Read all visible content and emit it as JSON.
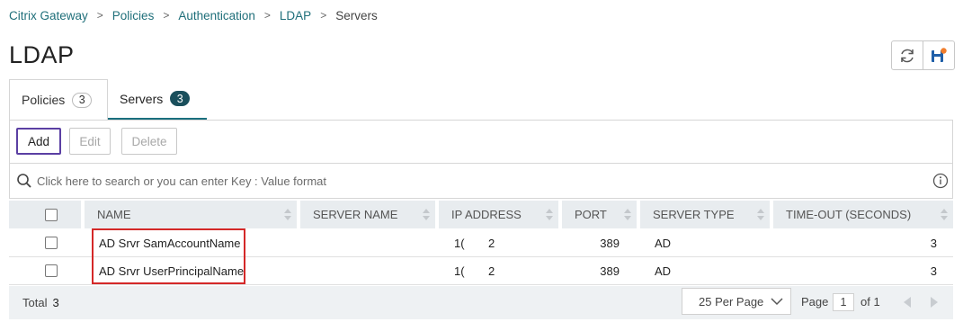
{
  "breadcrumb": {
    "items": [
      "Citrix Gateway",
      "Policies",
      "Authentication",
      "LDAP"
    ],
    "current": "Servers",
    "separator": ">"
  },
  "page_title": "LDAP",
  "toolbar": {
    "refresh_icon": "refresh-icon",
    "save_icon": "save-config-icon"
  },
  "tabs": [
    {
      "label": "Policies",
      "count": "3",
      "active": false
    },
    {
      "label": "Servers",
      "count": "3",
      "active": true
    }
  ],
  "actions": {
    "add": "Add",
    "edit": "Edit",
    "delete": "Delete"
  },
  "search": {
    "placeholder": "Click here to search or you can enter Key : Value format"
  },
  "table": {
    "columns": [
      "NAME",
      "SERVER NAME",
      "IP ADDRESS",
      "PORT",
      "SERVER TYPE",
      "TIME-OUT (SECONDS)"
    ],
    "rows": [
      {
        "name": "AD Srvr SamAccountName",
        "server_name": "",
        "ip_left": "1(",
        "ip_right": "2",
        "port": "389",
        "type": "AD",
        "timeout": "3"
      },
      {
        "name": "AD Srvr UserPrincipalName",
        "server_name": "",
        "ip_left": "1(",
        "ip_right": "2",
        "port": "389",
        "type": "AD",
        "timeout": "3"
      }
    ]
  },
  "footer": {
    "total_label": "Total",
    "total_count": "3",
    "per_page": "25 Per Page",
    "page_label": "Page",
    "page_number": "1",
    "page_of": "of 1"
  },
  "colors": {
    "accent": "#1f6f7a",
    "tab_active": "#1a6f7e",
    "highlight": "#d42828",
    "focus": "#5b3fa3"
  }
}
